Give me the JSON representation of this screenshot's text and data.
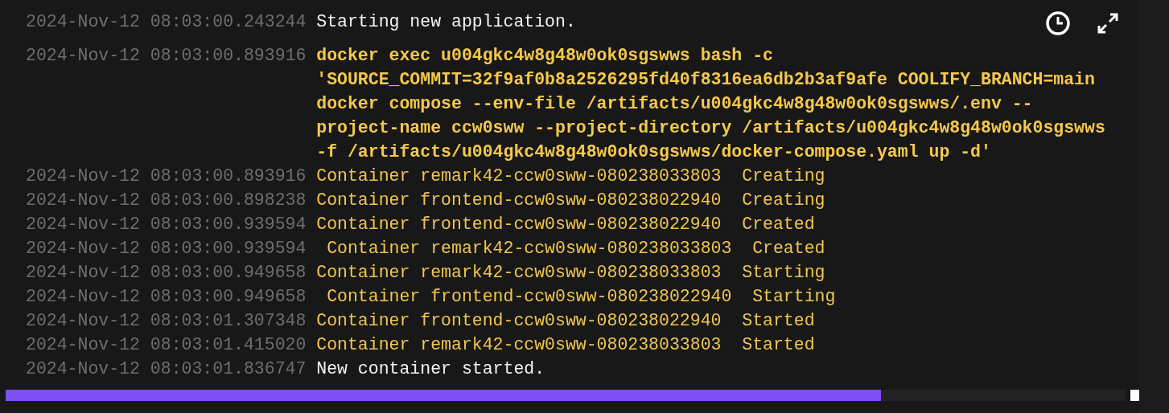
{
  "log": {
    "entries": [
      {
        "timestamp": "2024-Nov-12 08:03:00.243244",
        "message": "Starting new application.",
        "kind": "info"
      },
      {
        "timestamp": "2024-Nov-12 08:03:00.893916",
        "message": "docker exec u004gkc4w8g48w0ok0sgswws bash -c 'SOURCE_COMMIT=32f9af0b8a2526295fd40f8316ea6db2b3af9afe COOLIFY_BRANCH=main docker compose --env-file /artifacts/u004gkc4w8g48w0ok0sgswws/.env --project-name ccw0sww --project-directory /artifacts/u004gkc4w8g48w0ok0sgswws -f /artifacts/u004gkc4w8g48w0ok0sgswws/docker-compose.yaml up -d'",
        "kind": "command"
      },
      {
        "timestamp": "2024-Nov-12 08:03:00.893916",
        "message": "Container remark42-ccw0sww-080238033803  Creating",
        "kind": "output"
      },
      {
        "timestamp": "2024-Nov-12 08:03:00.898238",
        "message": "Container frontend-ccw0sww-080238022940  Creating",
        "kind": "output"
      },
      {
        "timestamp": "2024-Nov-12 08:03:00.939594",
        "message": "Container frontend-ccw0sww-080238022940  Created",
        "kind": "output"
      },
      {
        "timestamp": "2024-Nov-12 08:03:00.939594",
        "message": " Container remark42-ccw0sww-080238033803  Created",
        "kind": "output"
      },
      {
        "timestamp": "2024-Nov-12 08:03:00.949658",
        "message": "Container remark42-ccw0sww-080238033803  Starting",
        "kind": "output"
      },
      {
        "timestamp": "2024-Nov-12 08:03:00.949658",
        "message": " Container frontend-ccw0sww-080238022940  Starting",
        "kind": "output"
      },
      {
        "timestamp": "2024-Nov-12 08:03:01.307348",
        "message": "Container frontend-ccw0sww-080238022940  Started",
        "kind": "output"
      },
      {
        "timestamp": "2024-Nov-12 08:03:01.415020",
        "message": "Container remark42-ccw0sww-080238033803  Started",
        "kind": "output"
      },
      {
        "timestamp": "2024-Nov-12 08:03:01.836747",
        "message": "New container started.",
        "kind": "info"
      }
    ]
  }
}
